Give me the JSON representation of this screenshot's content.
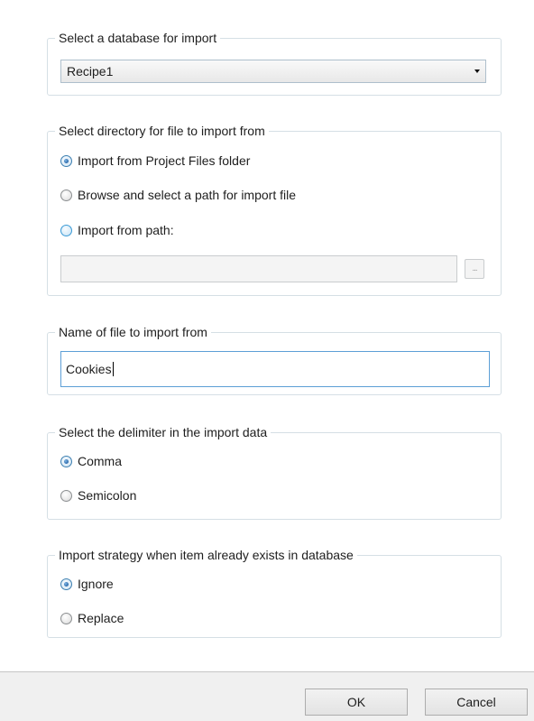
{
  "database": {
    "legend": "Select a database for import",
    "selected": "Recipe1"
  },
  "directory": {
    "legend": "Select directory for file to import from",
    "options": [
      {
        "label": "Import from Project Files folder",
        "checked": true
      },
      {
        "label": "Browse and select a path for import file",
        "checked": false
      },
      {
        "label": "Import from path:",
        "checked": false
      }
    ],
    "path_value": "",
    "browse_label": "..."
  },
  "filename": {
    "legend": "Name of file to import from",
    "value": "Cookies"
  },
  "delimiter": {
    "legend": "Select the delimiter in the import data",
    "options": [
      {
        "label": "Comma",
        "checked": true
      },
      {
        "label": "Semicolon",
        "checked": false
      }
    ]
  },
  "strategy": {
    "legend": "Import strategy when item already exists in database",
    "options": [
      {
        "label": "Ignore",
        "checked": true
      },
      {
        "label": "Replace",
        "checked": false
      }
    ]
  },
  "footer": {
    "ok_label": "OK",
    "cancel_label": "Cancel"
  }
}
